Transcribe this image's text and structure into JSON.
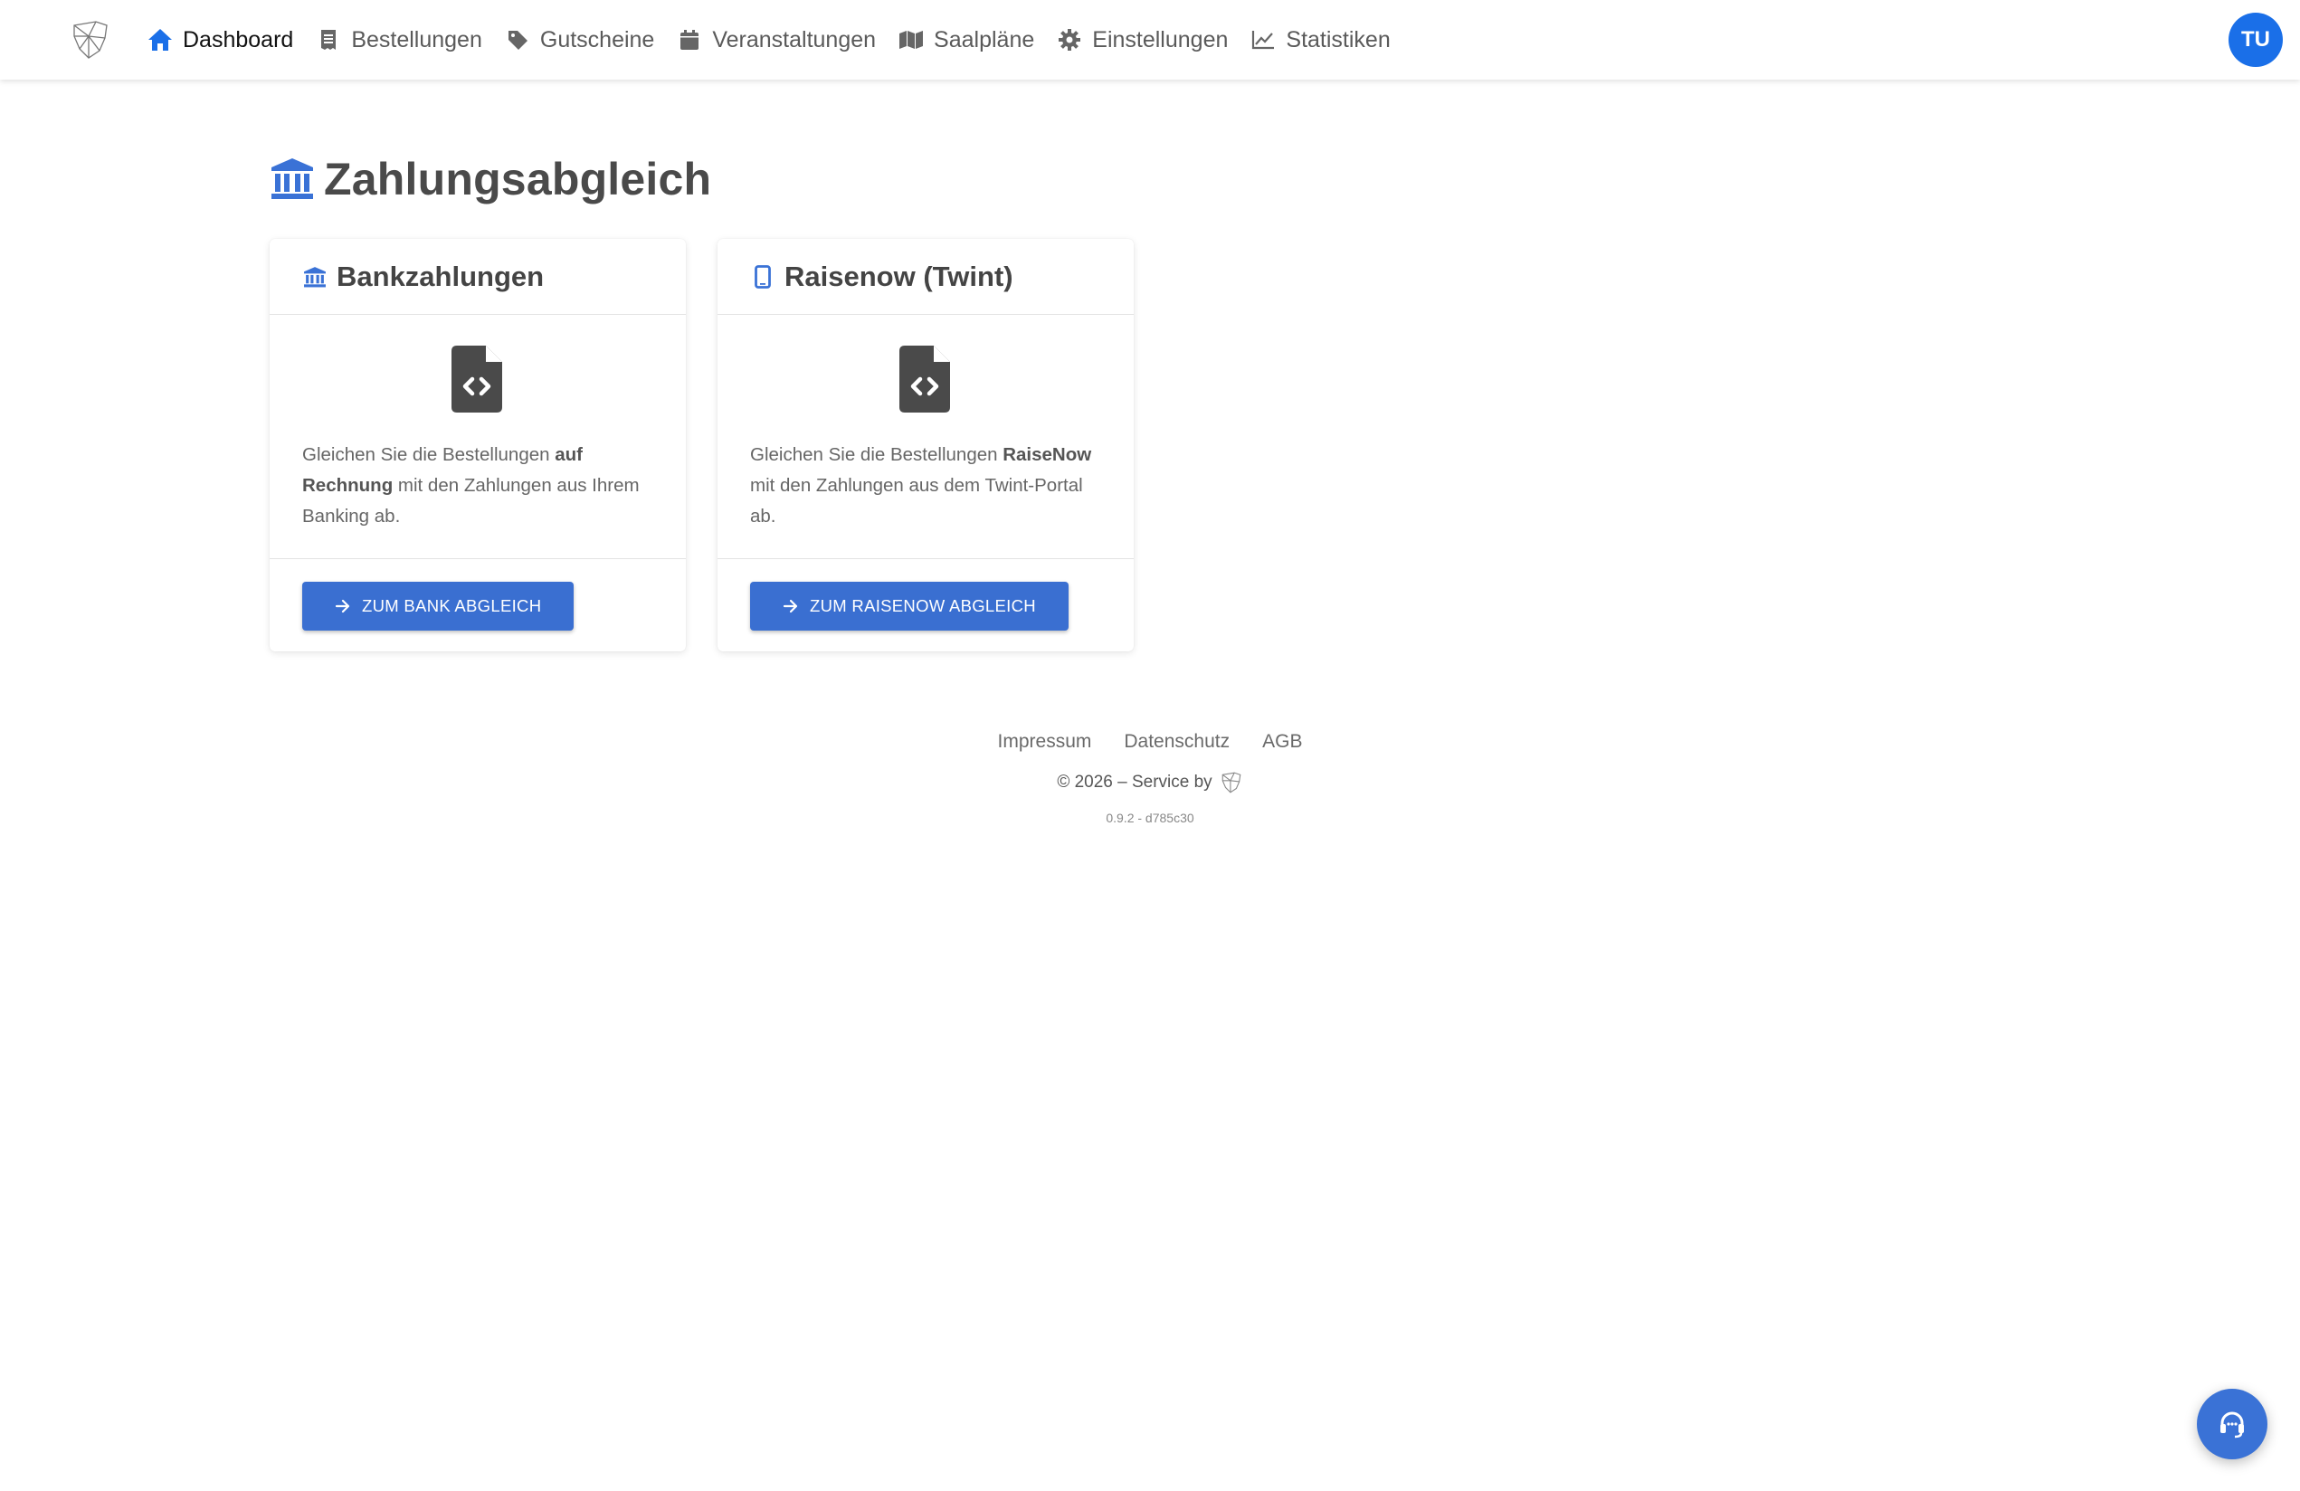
{
  "nav": {
    "items": [
      {
        "label": "Dashboard",
        "icon": "home-icon",
        "active": true
      },
      {
        "label": "Bestellungen",
        "icon": "receipt-icon"
      },
      {
        "label": "Gutscheine",
        "icon": "tag-icon"
      },
      {
        "label": "Veranstaltungen",
        "icon": "calendar-icon"
      },
      {
        "label": "Saalpläne",
        "icon": "map-icon"
      },
      {
        "label": "Einstellungen",
        "icon": "gear-icon"
      },
      {
        "label": "Statistiken",
        "icon": "chart-line-icon"
      }
    ],
    "avatar_initials": "TU"
  },
  "page": {
    "title": "Zahlungsabgleich"
  },
  "cards": {
    "bank": {
      "title": "Bankzahlungen",
      "text_pre": "Gleichen Sie die Bestellungen ",
      "text_bold": "auf Rechnung",
      "text_post": " mit den Zahlungen aus Ihrem Banking ab.",
      "button": "ZUM BANK ABGLEICH"
    },
    "raisenow": {
      "title": "Raisenow (Twint)",
      "text_pre": "Gleichen Sie die Bestellungen ",
      "text_bold": "RaiseNow",
      "text_post": " mit den Zahlungen aus dem Twint-Portal ab.",
      "button": "ZUM RAISENOW ABGLEICH"
    }
  },
  "footer": {
    "links": [
      "Impressum",
      "Datenschutz",
      "AGB"
    ],
    "copyright": "© 2026 – Service by",
    "version": "0.9.2 - d785c30"
  },
  "colors": {
    "accent": "#1a6fe8",
    "button": "#3a6fd1",
    "icon_blue": "#3a72d6",
    "title_gray": "#4a4a4a"
  }
}
